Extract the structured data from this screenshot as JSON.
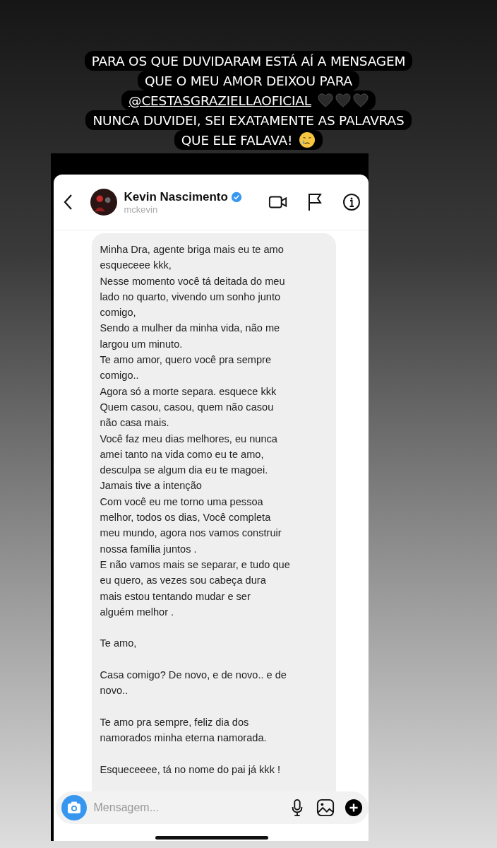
{
  "caption": {
    "lines": [
      {
        "text": "PARA OS QUE DUVIDARAM ESTÁ AÍ A MENSAGEM"
      },
      {
        "text": "QUE O MEU AMOR DEIXOU PARA"
      },
      {
        "text": "@CESTASGRAZIELLAOFICIAL",
        "kind": "mention",
        "emojis": [
          {
            "kind": "black-heart"
          },
          {
            "kind": "black-heart"
          },
          {
            "kind": "black-heart"
          }
        ]
      },
      {
        "text": "NUNCA DUVIDEI, SEI EXATAMENTE AS PALAVRAS"
      },
      {
        "text": "QUE ELE FALAVA!",
        "emojis": [
          {
            "kind": "crying-face"
          }
        ]
      }
    ]
  },
  "chat": {
    "name": "Kevin Nascimento",
    "verified": true,
    "username": "mckevin",
    "message": [
      "Minha Dra, agente briga mais eu te amo\nesqueceee kkk,\nNesse momento você tá deitada do meu\nlado no quarto, vivendo um sonho junto\ncomigo,\nSendo a mulher da minha vida, não me\nlargou um minuto.\nTe amo amor, quero você pra sempre\ncomigo..\nAgora só a morte separa. esquece kkk\nQuem casou, casou, quem não casou\nnão casa mais.\nVocê faz meu dias melhores, eu nunca\namei tanto na vida como eu te amo,\ndesculpa se algum dia eu te magoei.\nJamais tive a intenção\nCom você eu me torno uma pessoa\nmelhor, todos os dias, Você completa\nmeu mundo, agora nos vamos construir\nnossa família juntos .\nE não vamos mais se separar, e tudo que\neu quero, as vezes sou cabeça dura\nmais estou tentando mudar e ser\nalguém melhor .",
      "Te amo,",
      "Casa comigo? De novo, e de novo.. e de\nnovo..",
      "Te amo pra sempre, feliz dia dos\nnamorados minha eterna namorada.",
      "Esqueceeee, tá no nome do pai já kkk !"
    ],
    "input": {
      "placeholder": "Mensagem..."
    }
  }
}
